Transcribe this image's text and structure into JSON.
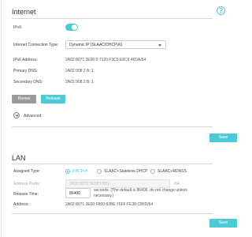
{
  "internet": {
    "title": "Internet",
    "ipv6_label": "IPv6:",
    "ipv6_enabled": true,
    "connection_type_label": "Internet Connection Type:",
    "connection_type_value": "Dynamic IP (SLAAC/DHCPv6)",
    "ipv6_address_label": "IPv6 Address:",
    "ipv6_address_value": "2A02:8071:3E00:0:7120:F3C5:E8C8:46DA/64",
    "primary_dns_label": "Primary DNS:",
    "primary_dns_value": "2A02:908:2:A::1",
    "secondary_dns_label": "Secondary DNS:",
    "secondary_dns_value": "2A02:908:2:B::1",
    "renew_label": "Renew",
    "release_label": "Release",
    "advanced_label": "Advanced",
    "save_label": "Save"
  },
  "lan": {
    "title": "LAN",
    "assigned_type_label": "Assigned Type:",
    "assigned_options": [
      "DHCPv6",
      "SLAAC+Stateless DHCP",
      "SLAAC+RDNSS"
    ],
    "assigned_selected": "DHCPv6",
    "address_prefix_label": "Address Prefix:",
    "address_prefix_value": "2A02:8071:3E00:F800::",
    "address_prefix_suffix": "/64",
    "release_time_label": "Release Time:",
    "release_time_value": "86400",
    "release_time_note": "seconds. (The default is 86400, do not change unless necessary.)",
    "address_label": "Address:",
    "address_value": "2A02:8071:3E00:F800:82BE:76FF:FE38:C86D/64",
    "save_label": "Save"
  },
  "colors": {
    "accent": "#4acbd6",
    "renew_button": "#9b9b9b"
  },
  "icons": {
    "help": "question-circle-icon",
    "advanced": "chevron-down-circle-icon"
  },
  "help_glyph": "?"
}
